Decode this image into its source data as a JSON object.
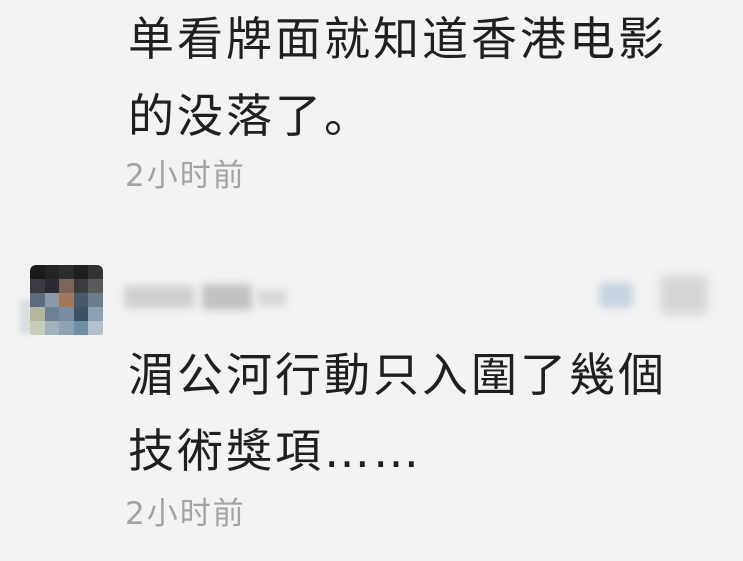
{
  "colors": {
    "background": "#f3f3f3",
    "text": "#1f1f1f",
    "meta": "#a3a3a3"
  },
  "comments": [
    {
      "text_lines": [
        "单看牌面就知道香港电影",
        "的没落了。"
      ],
      "time": "2小时前"
    },
    {
      "text_lines": [
        "湄公河行動只入圍了幾個",
        "技術獎項……"
      ],
      "time": "2小时前"
    }
  ]
}
